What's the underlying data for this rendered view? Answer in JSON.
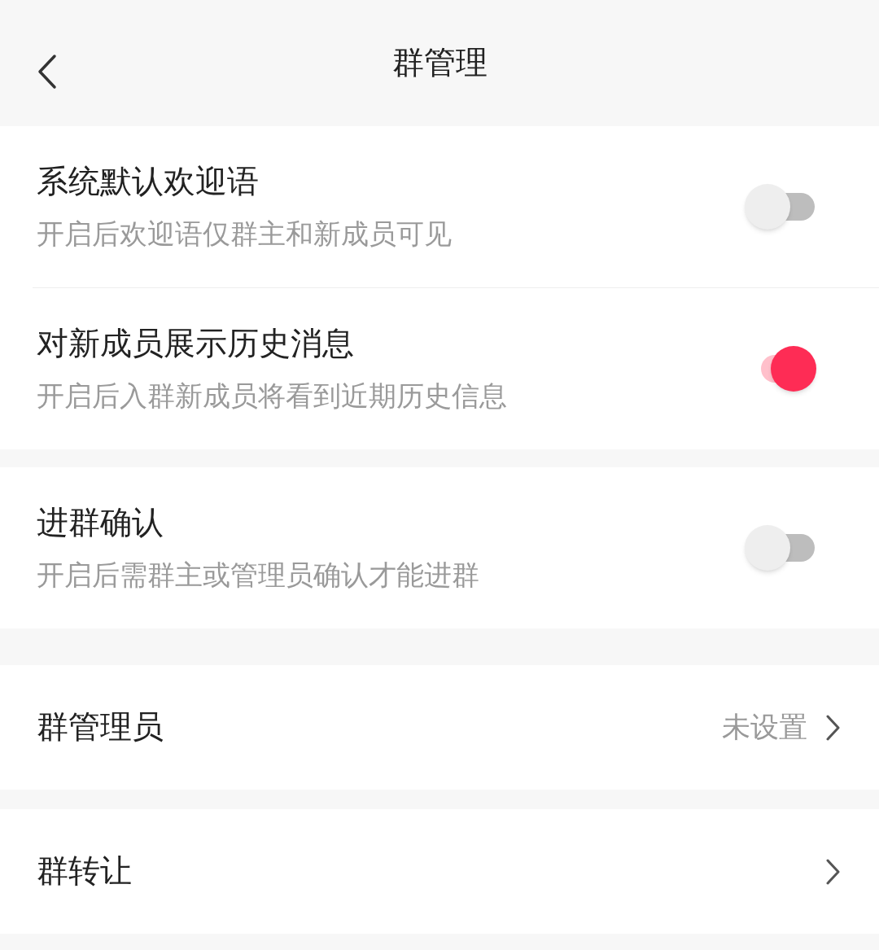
{
  "header": {
    "title": "群管理"
  },
  "sections": [
    {
      "rows": [
        {
          "kind": "toggle",
          "title": "系统默认欢迎语",
          "subtitle": "开启后欢迎语仅群主和新成员可见",
          "on": false
        },
        {
          "kind": "toggle",
          "title": "对新成员展示历史消息",
          "subtitle": "开启后入群新成员将看到近期历史信息",
          "on": true
        }
      ]
    },
    {
      "rows": [
        {
          "kind": "toggle",
          "title": "进群确认",
          "subtitle": "开启后需群主或管理员确认才能进群",
          "on": false
        }
      ]
    },
    {
      "rows": [
        {
          "kind": "link",
          "title": "群管理员",
          "value": "未设置"
        }
      ]
    },
    {
      "rows": [
        {
          "kind": "link",
          "title": "群转让"
        }
      ]
    }
  ]
}
